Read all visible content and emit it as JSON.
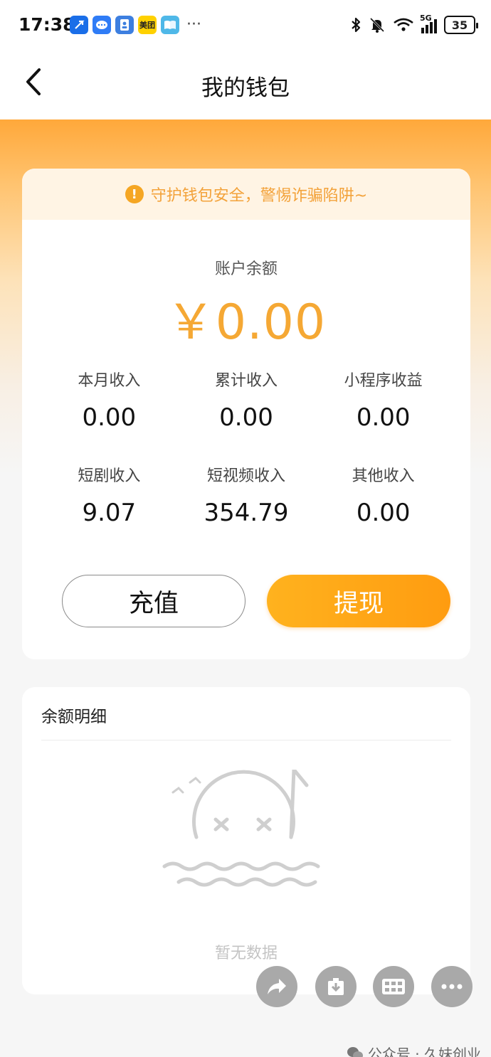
{
  "status_bar": {
    "time": "17:38",
    "network": "5G",
    "battery": "35",
    "apps": [
      {
        "icon": "arrow-app-icon",
        "color": "#1a6ee8"
      },
      {
        "icon": "chat-app-icon",
        "color": "#2f7cf6"
      },
      {
        "icon": "contact-app-icon",
        "color": "#3d7fe0"
      },
      {
        "icon": "meituan-app-icon",
        "color": "#ffd100",
        "label": "美团"
      },
      {
        "icon": "book-app-icon",
        "color": "#4fb8e8"
      }
    ],
    "more": "···"
  },
  "nav": {
    "title": "我的钱包"
  },
  "notice": {
    "icon_text": "!",
    "text": "守护钱包安全，警惕诈骗陷阱~"
  },
  "balance": {
    "label": "账户余额",
    "amount": "￥0.00"
  },
  "stats": [
    {
      "label": "本月收入",
      "value": "0.00"
    },
    {
      "label": "累计收入",
      "value": "0.00"
    },
    {
      "label": "小程序收益",
      "value": "0.00"
    },
    {
      "label": "短剧收入",
      "value": "9.07"
    },
    {
      "label": "短视频收入",
      "value": "354.79"
    },
    {
      "label": "其他收入",
      "value": "0.00"
    }
  ],
  "actions": {
    "recharge": "充值",
    "withdraw": "提现"
  },
  "details": {
    "title": "余额明细",
    "empty_text": "暂无数据"
  },
  "watermark": "公众号 · 久妹创业",
  "colors": {
    "accent": "#f5a834",
    "button_orange": "#ffa516",
    "notice_bg": "#fff4e4",
    "notice_text": "#f3a23a"
  }
}
